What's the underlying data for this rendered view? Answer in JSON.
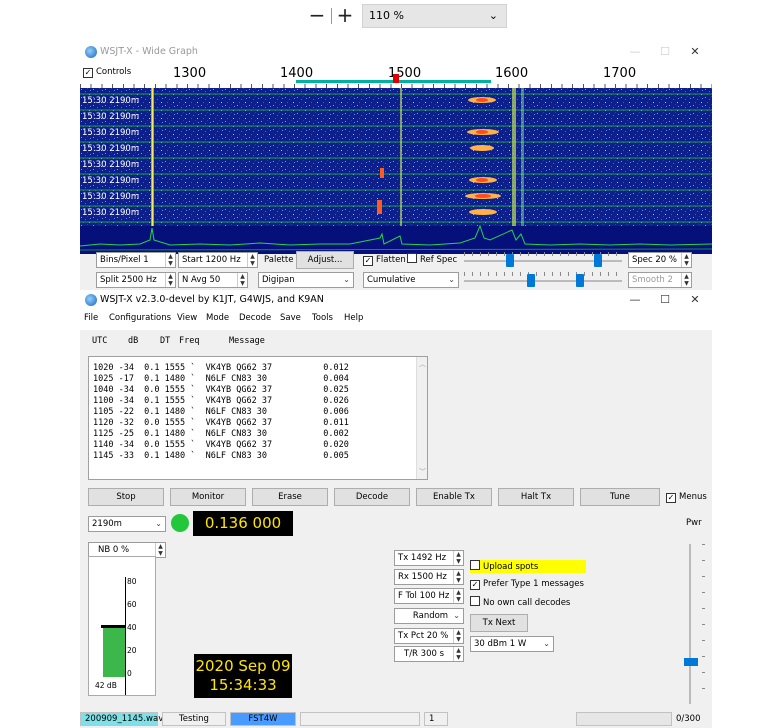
{
  "zoom": {
    "minus": "−",
    "plus": "+",
    "level": "110 %"
  },
  "wide_graph": {
    "title": "WSJT-X - Wide Graph",
    "controls_label": "Controls",
    "freq_labels": [
      "1300",
      "1400",
      "1500",
      "1600",
      "1700"
    ],
    "row_labels": [
      "15:30  2190m",
      "15:30  2190m",
      "15:30  2190m",
      "15:30  2190m",
      "15:30  2190m",
      "15:30  2190m",
      "15:30  2190m",
      "15:30  2190m"
    ],
    "bins_per_pixel": "Bins/Pixel  1",
    "start": "Start 1200 Hz",
    "palette_label": "Palette",
    "adjust": "Adjust...",
    "flatten": "Flatten",
    "ref_spec": "Ref Spec",
    "spec": "Spec 20 %",
    "split": "Split  2500  Hz",
    "n_avg": "N Avg 50",
    "palette_value": "Digipan",
    "cumulative": "Cumulative",
    "smooth": "Smooth  2"
  },
  "main": {
    "title": "WSJT-X   v2.3.0-devel   by K1JT, G4WJS, and K9AN",
    "menus": [
      "File",
      "Configurations",
      "View",
      "Mode",
      "Decode",
      "Save",
      "Tools",
      "Help"
    ],
    "header": {
      "utc": "UTC",
      "db": "dB",
      "dt": "DT",
      "freq": "Freq",
      "message": "Message"
    },
    "decodes": [
      "1020 -34  0.1 1555 `  VK4YB QG62 37          0.012",
      "1025 -17  0.1 1480 `  N6LF CN83 30           0.004",
      "1040 -34  0.0 1555 `  VK4YB QG62 37          0.025",
      "1100 -34  0.1 1555 `  VK4YB QG62 37          0.026",
      "1105 -22  0.1 1480 `  N6LF CN83 30           0.006",
      "1120 -32  0.0 1555 `  VK4YB QG62 37          0.011",
      "1125 -25  0.1 1480 `  N6LF CN83 30           0.002",
      "1140 -34  0.0 1555 `  VK4YB QG62 37          0.020",
      "1145 -33  0.1 1480 `  N6LF CN83 30           0.005"
    ],
    "buttons": {
      "stop": "Stop",
      "monitor": "Monitor",
      "erase": "Erase",
      "decode": "Decode",
      "enable_tx": "Enable Tx",
      "halt_tx": "Halt Tx",
      "tune": "Tune",
      "menus": "Menus"
    },
    "band": "2190m",
    "dial_freq": "0.136 000",
    "pwr": "Pwr",
    "nb": "NB  0  %",
    "meter_ticks": [
      "80",
      "60",
      "40",
      "20",
      "0"
    ],
    "meter_db": "42 dB",
    "date": "2020 Sep 09",
    "time": "15:34:33",
    "tx": "Tx  1492  Hz",
    "rx": "Rx  1500  Hz",
    "ftol": "F Tol  100  Hz",
    "random": "Random",
    "tx_pct": "Tx Pct 20  %",
    "tr": "T/R  300  s",
    "upload_spots": "Upload spots",
    "prefer_type1": "Prefer Type 1 messages",
    "no_own_call": "No own call decodes",
    "tx_next": "Tx Next",
    "power": "30 dBm  1 W",
    "status": {
      "file": "200909_1145.wav",
      "mode_state": "Testing",
      "mode": "FST4W",
      "count": "1",
      "progress": "0/300"
    },
    "colors": {
      "lcd_bg": "#000000",
      "lcd_fg": "#ffe600",
      "led": "#22c73a",
      "highlight": "#ffff00",
      "mode_badge": "#4a9bff",
      "file_badge": "#7fe0e8"
    }
  }
}
